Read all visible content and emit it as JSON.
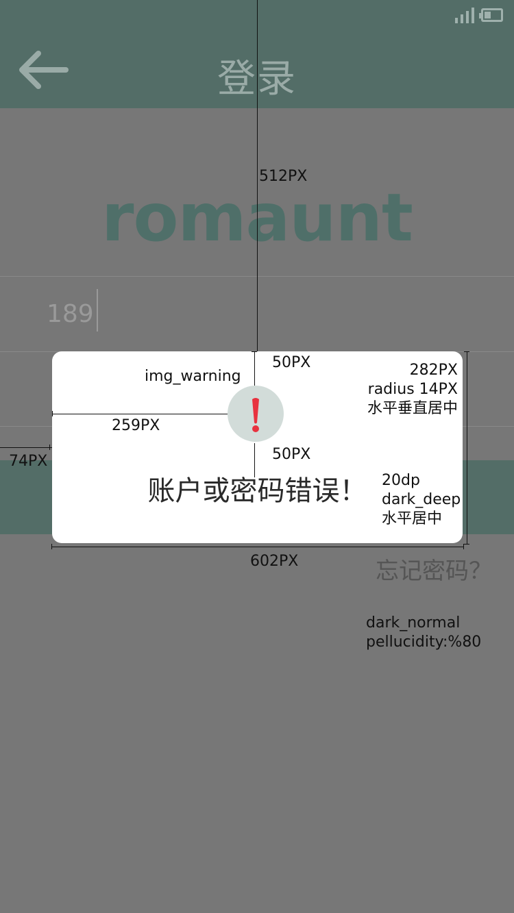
{
  "status_bar": {
    "signal_icon": "signal-icon",
    "battery_icon": "battery-icon"
  },
  "header": {
    "back_icon": "back-arrow-icon",
    "title": "登录",
    "background": "#536d67"
  },
  "brand": {
    "logo_text": "romaunt",
    "color": "#4f6f69"
  },
  "form": {
    "phone_value": "189",
    "forgot_password": "忘记密码？"
  },
  "dialog": {
    "icon": "warning-icon",
    "icon_color": "#e8323f",
    "icon_bg": "#d2dcd9",
    "message": "账户或密码错误！"
  },
  "annotations": {
    "top_offset": "512PX",
    "icon_top": "50PX",
    "icon_bottom": "50PX",
    "icon_left": "259PX",
    "dialog_left": "74PX",
    "dialog_width": "602PX",
    "img_label": "img_warning",
    "dialog_height": "282PX",
    "dialog_radius": "radius 14PX",
    "dialog_align": "水平垂直居中",
    "text_size": "20dp",
    "text_color": "dark_deep",
    "text_align": "水平居中",
    "overlay_color": "dark_normal",
    "overlay_opacity": "pellucidity:%80"
  }
}
